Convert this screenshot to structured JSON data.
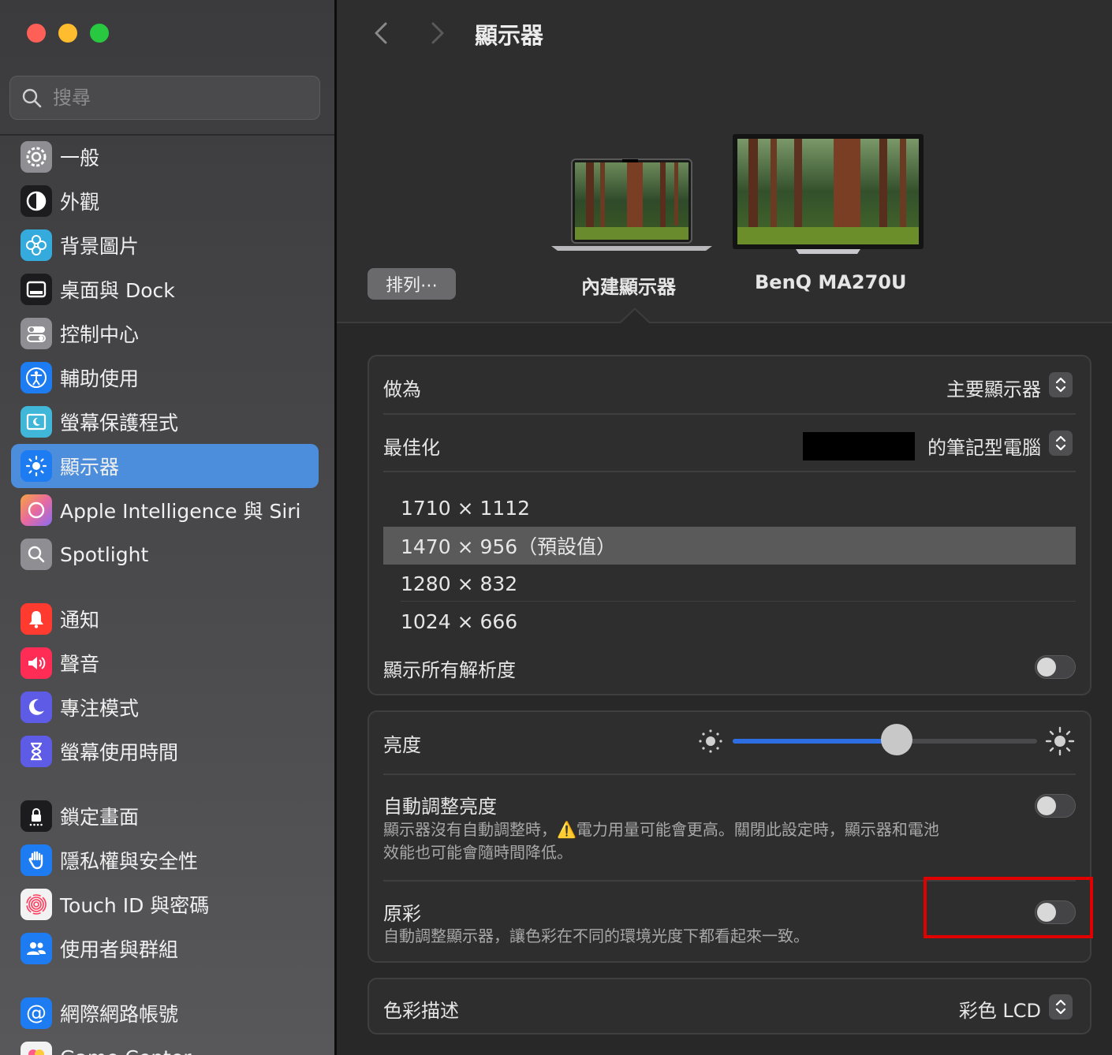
{
  "window": {
    "title": "顯示器"
  },
  "search": {
    "placeholder": "搜尋"
  },
  "sidebar": {
    "items": [
      {
        "label": "一般",
        "icon": "gear-icon",
        "color": "#8e8e93"
      },
      {
        "label": "外觀",
        "icon": "appearance-icon",
        "color": "#1c1c1e"
      },
      {
        "label": "背景圖片",
        "icon": "wallpaper-icon",
        "color": "#35aadc"
      },
      {
        "label": "桌面與 Dock",
        "icon": "dock-icon",
        "color": "#1c1c1e"
      },
      {
        "label": "控制中心",
        "icon": "control-center-icon",
        "color": "#8e8e93"
      },
      {
        "label": "輔助使用",
        "icon": "accessibility-icon",
        "color": "#1d7cf2"
      },
      {
        "label": "螢幕保護程式",
        "icon": "screensaver-icon",
        "color": "#40b6d8"
      },
      {
        "label": "顯示器",
        "icon": "display-sun-icon",
        "color": "#1d7cf2",
        "selected": true
      },
      {
        "label": "Apple Intelligence 與 Siri",
        "icon": "siri-icon",
        "color": "#e86aa0"
      },
      {
        "label": "Spotlight",
        "icon": "spotlight-icon",
        "color": "#8e8e93"
      },
      {
        "label": "通知",
        "icon": "bell-icon",
        "color": "#ff3b30"
      },
      {
        "label": "聲音",
        "icon": "speaker-icon",
        "color": "#ff2d55"
      },
      {
        "label": "專注模式",
        "icon": "moon-icon",
        "color": "#5e5ce6"
      },
      {
        "label": "螢幕使用時間",
        "icon": "hourglass-icon",
        "color": "#5e5ce6"
      },
      {
        "label": "鎖定畫面",
        "icon": "lock-icon",
        "color": "#1c1c1e"
      },
      {
        "label": "隱私權與安全性",
        "icon": "hand-icon",
        "color": "#1d7cf2"
      },
      {
        "label": "Touch ID 與密碼",
        "icon": "fingerprint-icon",
        "color": "#f2f2f2"
      },
      {
        "label": "使用者與群組",
        "icon": "users-icon",
        "color": "#1d7cf2"
      },
      {
        "label": "網際網路帳號",
        "icon": "at-icon",
        "color": "#1d7cf2"
      },
      {
        "label": "Game Center",
        "icon": "game-center-icon",
        "color": "#f2f2f2"
      }
    ]
  },
  "header": {
    "back_icon": "chevron-left-icon",
    "forward_icon": "chevron-right-icon",
    "title": "顯示器"
  },
  "displays": {
    "arrange_label": "排列⋯",
    "builtin_name": "內建顯示器",
    "external_name": "BenQ MA270U"
  },
  "settings": {
    "use_as": {
      "label": "做為",
      "value": "主要顯示器"
    },
    "optimize": {
      "label": "最佳化",
      "value": "的筆記型電腦"
    },
    "resolutions": [
      "1710 × 1112",
      "1470 × 956（預設值）",
      "1280 × 832",
      "1024 × 666"
    ],
    "selected_resolution_index": 1,
    "show_all_resolutions": {
      "label": "顯示所有解析度",
      "on": false
    },
    "brightness": {
      "label": "亮度",
      "level": 0.54
    },
    "auto_brightness": {
      "label": "自動調整亮度",
      "desc_line1": "顯示器沒有自動調整時，⚠️電力用量可能會更高。關閉此設定時，顯示器和電池",
      "desc_line2": "效能也可能會隨時間降低。",
      "on": false
    },
    "true_tone": {
      "label": "原彩",
      "desc": "自動調整顯示器，讓色彩在不同的環境光度下都看起來一致。",
      "on": false
    },
    "color_profile": {
      "label": "色彩描述",
      "value": "彩色 LCD"
    }
  },
  "colors": {
    "accent": "#2d6fe2",
    "selected_sidebar": "#4d8edc",
    "highlight": "#e00000"
  }
}
